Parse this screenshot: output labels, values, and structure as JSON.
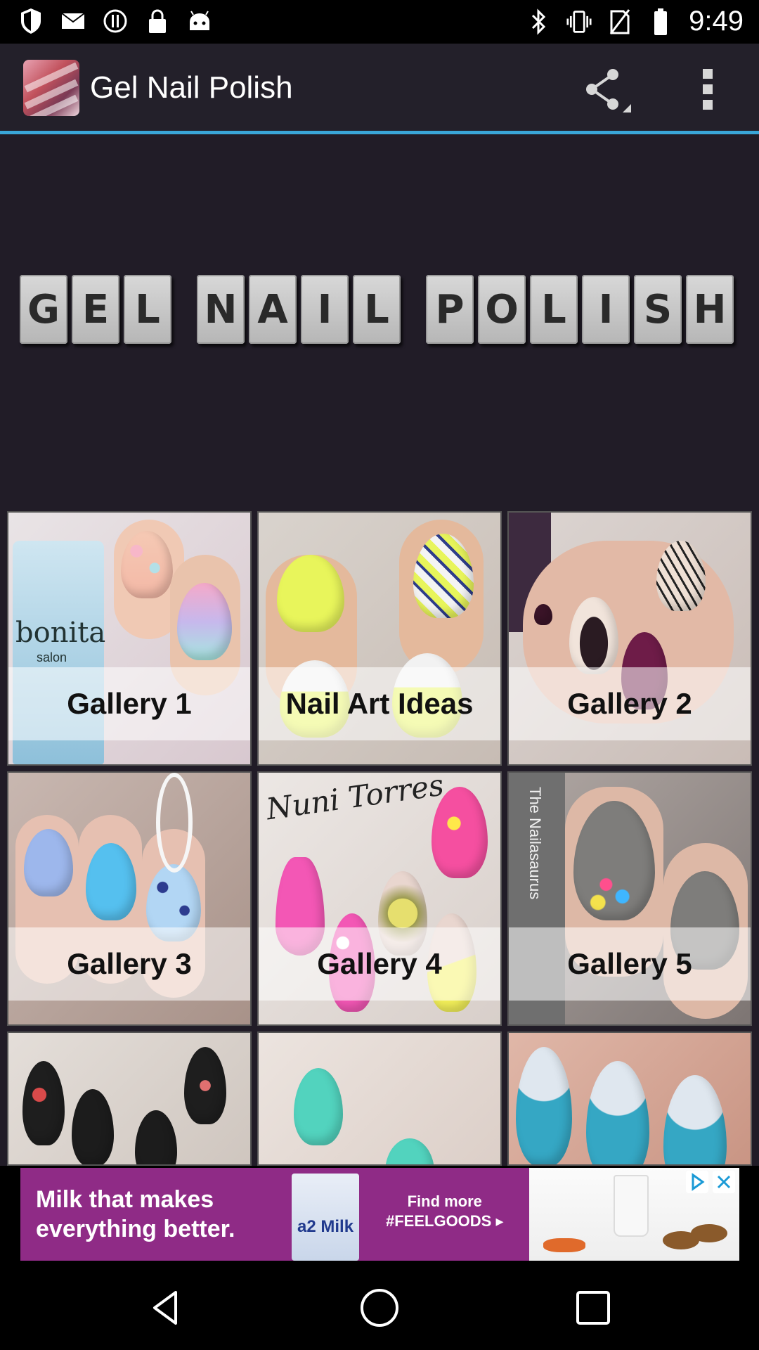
{
  "status_bar": {
    "time": "9:49",
    "left_icons": [
      "shield-icon",
      "mail-icon",
      "alert-icon",
      "lock-icon",
      "android-icon"
    ],
    "right_icons": [
      "bluetooth-icon",
      "vibrate-icon",
      "no-sim-icon",
      "battery-icon"
    ]
  },
  "app_bar": {
    "title": "Gel Nail Polish",
    "icons": [
      "app-logo-icon",
      "share-icon",
      "more-vert-icon"
    ]
  },
  "hero": {
    "words": [
      [
        "G",
        "E",
        "L"
      ],
      [
        "N",
        "A",
        "I",
        "L"
      ],
      [
        "P",
        "O",
        "L",
        "I",
        "S",
        "H"
      ]
    ]
  },
  "grid": {
    "items": [
      {
        "label": "Gallery 1"
      },
      {
        "label": "Nail Art Ideas"
      },
      {
        "label": "Gallery 2"
      },
      {
        "label": "Gallery 3"
      },
      {
        "label": "Gallery 4"
      },
      {
        "label": "Gallery 5"
      },
      {
        "label": ""
      },
      {
        "label": ""
      },
      {
        "label": ""
      }
    ],
    "image_texts": {
      "bottle": "bonita",
      "bottle_sub": "salon",
      "signature": "Nuni Torres",
      "watermark": "The Nailasaurus"
    }
  },
  "ad": {
    "headline_1": "Milk that makes",
    "headline_2": "everything better.",
    "brand": "a2 Milk",
    "cta_1": "Find more",
    "cta_2": "#FEELGOODS ▸"
  },
  "nav_bar": {
    "icons": [
      "back-icon",
      "home-icon",
      "recents-icon"
    ]
  },
  "colors": {
    "app_bar_bg": "#23202a",
    "accent_line": "#3aa6d8",
    "hero_bg": "#211c27",
    "ad_bg": "#8f2b86"
  }
}
